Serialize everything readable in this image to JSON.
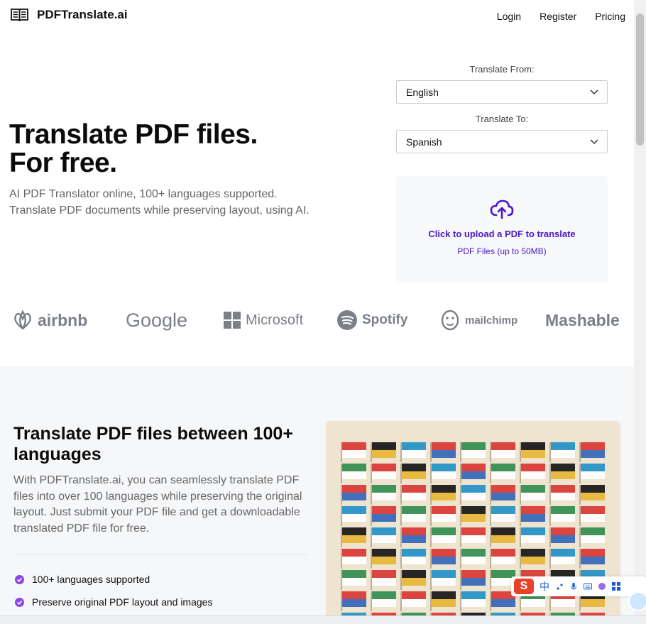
{
  "header": {
    "logo_text": "PDFTranslate.ai",
    "nav": [
      "Login",
      "Register",
      "Pricing"
    ]
  },
  "hero": {
    "title_line1": "Translate PDF files.",
    "title_line2": "For free.",
    "subtitle_line1": "AI PDF Translator online, 100+ languages supported.",
    "subtitle_line2": "Translate PDF documents while preserving layout, using AI."
  },
  "form": {
    "from_label": "Translate From:",
    "from_value": "English",
    "to_label": "Translate To:",
    "to_value": "Spanish"
  },
  "upload": {
    "title": "Click to upload a PDF to translate",
    "subtitle": "PDF Files (up to 50MB)"
  },
  "brands": [
    "airbnb",
    "Google",
    "Microsoft",
    "Spotify",
    "mailchimp",
    "Mashable"
  ],
  "section": {
    "title": "Translate PDF files between 100+ languages",
    "body": "With PDFTranslate.ai, you can seamlessly translate PDF files into over 100 languages while preserving the original layout. Just submit your PDF file and get a downloadable translated PDF file for free.",
    "features": [
      "100+ languages supported",
      "Preserve original PDF layout and images"
    ]
  },
  "ime": {
    "logo": "S",
    "lang": "中"
  },
  "colors": {
    "accent": "#4b17c9",
    "highlight": "#f7ca3e",
    "check": "#8b46e8",
    "brand_gray": "#7b7f87"
  }
}
